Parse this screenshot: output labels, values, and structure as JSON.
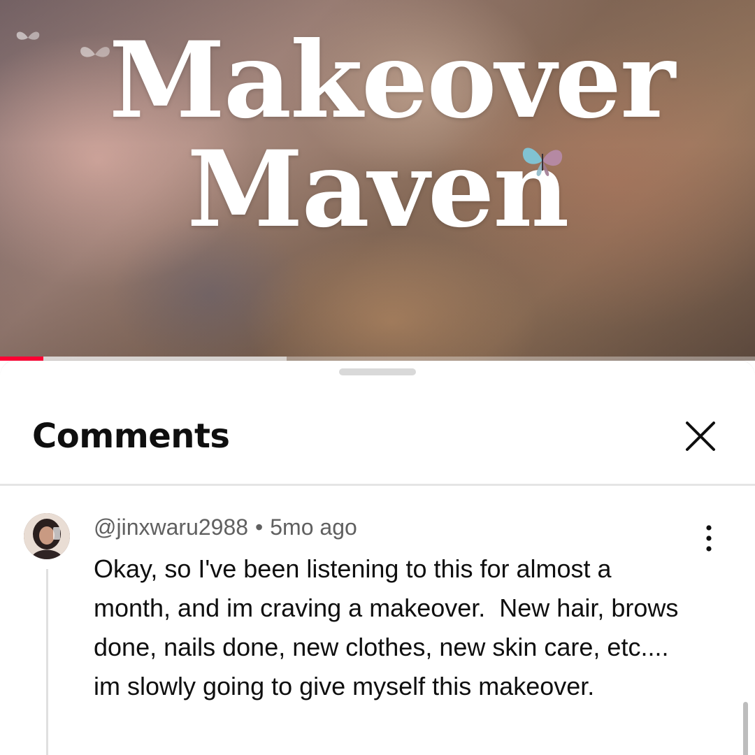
{
  "video": {
    "title_line1": "Makeover",
    "title_line2": "Maven",
    "progress_fraction": 0.057,
    "buffered_fraction": 0.38,
    "accent_color": "#ff0033"
  },
  "comments_panel": {
    "title": "Comments",
    "close_icon": "close-icon",
    "drag_handle_icon": "drag-handle"
  },
  "comments": [
    {
      "author": "@jinxwaru2988",
      "separator": "•",
      "time": "5mo ago",
      "text": "Okay, so I've been listening to this for almost a month, and im craving a makeover.  New hair, brows done, nails done, new clothes, new skin care, etc.... im slowly going to give myself this makeover.",
      "menu_icon": "more-vert-icon",
      "avatar_icon": "avatar"
    }
  ]
}
